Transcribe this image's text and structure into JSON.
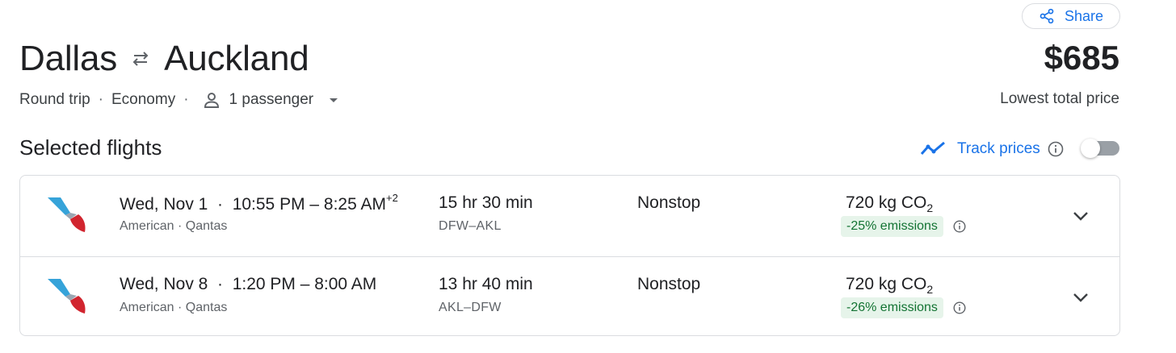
{
  "header": {
    "share_label": "Share",
    "origin": "Dallas",
    "destination": "Auckland",
    "price": "$685",
    "price_caption": "Lowest total price"
  },
  "trip_options": {
    "trip_type": "Round trip",
    "cabin": "Economy",
    "passengers": "1 passenger"
  },
  "section": {
    "title": "Selected flights",
    "track_label": "Track prices",
    "track_enabled": false
  },
  "flights": [
    {
      "date": "Wed, Nov 1",
      "times": "10:55 PM – 8:25 AM",
      "day_offset": "+2",
      "airlines": "American · Qantas",
      "duration": "15 hr 30 min",
      "route_codes": "DFW–AKL",
      "stops": "Nonstop",
      "co2_value": "720 kg CO",
      "co2_sub": "2",
      "emissions": "-25% emissions"
    },
    {
      "date": "Wed, Nov 8",
      "times": "1:20 PM – 8:00 AM",
      "day_offset": "",
      "airlines": "American · Qantas",
      "duration": "13 hr 40 min",
      "route_codes": "AKL–DFW",
      "stops": "Nonstop",
      "co2_value": "720 kg CO",
      "co2_sub": "2",
      "emissions": "-26% emissions"
    }
  ],
  "colors": {
    "accent": "#1a73e8",
    "emissions_bg": "#e6f4ea",
    "emissions_text": "#137333",
    "aa_red": "#d1252f",
    "aa_blue": "#36a3d9"
  },
  "icons": [
    "share-icon",
    "swap-arrows-icon",
    "person-icon",
    "dropdown-caret-icon",
    "trend-line-icon",
    "info-icon",
    "american-airlines-logo",
    "chevron-down-icon"
  ]
}
